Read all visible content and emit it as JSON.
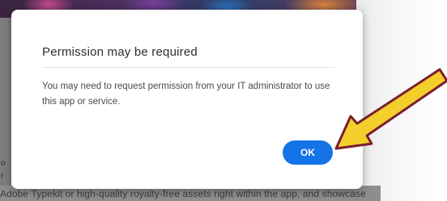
{
  "dialog": {
    "title": "Permission may be required",
    "body": "You may need to request permission from your IT administrator to use this app or service.",
    "ok_label": "OK"
  },
  "backdrop": {
    "footer_text": "Adobe Typekit or high-quality royalty-free assets right within the app, and showcase",
    "stray_a": "o",
    "stray_b": "r"
  },
  "annotation": {
    "icon": "arrow-pointing-to-ok-icon",
    "fill_color": "#f2cf2b",
    "outline_color": "#7a1f2e"
  },
  "colors": {
    "button": "#1473e6"
  }
}
